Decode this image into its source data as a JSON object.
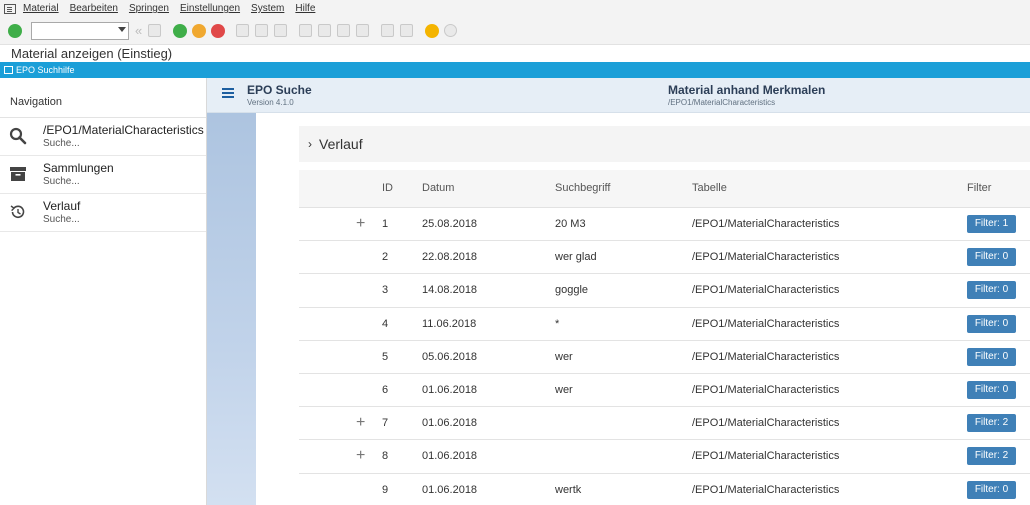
{
  "menubar": {
    "items": [
      "Material",
      "Bearbeiten",
      "Springen",
      "Einstellungen",
      "System",
      "Hilfe"
    ]
  },
  "toolbar": {
    "command_field": "",
    "icons": [
      "enter-icon",
      "save-icon",
      "back-icon",
      "exit-icon",
      "cancel-icon",
      "print-icon",
      "find-icon",
      "find-next-icon",
      "first-page-icon",
      "previous-page-icon",
      "next-page-icon",
      "last-page-icon",
      "create-session-icon",
      "shortcut-icon",
      "help-icon",
      "settings-icon"
    ]
  },
  "titlebar": {
    "title": "Material anzeigen (Einstieg)"
  },
  "window": {
    "title": "EPO Suchhilfe"
  },
  "navigation": {
    "header": "Navigation",
    "items": [
      {
        "title": "/EPO1/MaterialCharacteristics",
        "subtitle": "Suche...",
        "icon": "search-icon"
      },
      {
        "title": "Sammlungen",
        "subtitle": "Suche...",
        "icon": "archive-box-icon"
      },
      {
        "title": "Verlauf",
        "subtitle": "Suche...",
        "icon": "history-icon"
      }
    ]
  },
  "header": {
    "app_title": "EPO Suche",
    "version": "Version 4.1.0",
    "page_title": "Material anhand Merkmalen",
    "page_subtitle": "/EPO1/MaterialCharacteristics"
  },
  "verlauf": {
    "title": "Verlauf"
  },
  "table": {
    "columns": {
      "id": "ID",
      "date": "Datum",
      "term": "Suchbegriff",
      "table": "Tabelle",
      "filter": "Filter"
    },
    "rows": [
      {
        "expand": "+",
        "id": "1",
        "date": "25.08.2018",
        "term": "20 M3",
        "table": "/EPO1/MaterialCharacteristics",
        "filter": "Filter: 1"
      },
      {
        "expand": "",
        "id": "2",
        "date": "22.08.2018",
        "term": "wer glad",
        "table": "/EPO1/MaterialCharacteristics",
        "filter": "Filter: 0"
      },
      {
        "expand": "",
        "id": "3",
        "date": "14.08.2018",
        "term": "goggle",
        "table": "/EPO1/MaterialCharacteristics",
        "filter": "Filter: 0"
      },
      {
        "expand": "",
        "id": "4",
        "date": "11.06.2018",
        "term": "*",
        "table": "/EPO1/MaterialCharacteristics",
        "filter": "Filter: 0"
      },
      {
        "expand": "",
        "id": "5",
        "date": "05.06.2018",
        "term": "wer",
        "table": "/EPO1/MaterialCharacteristics",
        "filter": "Filter: 0"
      },
      {
        "expand": "",
        "id": "6",
        "date": "01.06.2018",
        "term": "wer",
        "table": "/EPO1/MaterialCharacteristics",
        "filter": "Filter: 0"
      },
      {
        "expand": "+",
        "id": "7",
        "date": "01.06.2018",
        "term": "",
        "table": "/EPO1/MaterialCharacteristics",
        "filter": "Filter: 2"
      },
      {
        "expand": "+",
        "id": "8",
        "date": "01.06.2018",
        "term": "",
        "table": "/EPO1/MaterialCharacteristics",
        "filter": "Filter: 2"
      },
      {
        "expand": "",
        "id": "9",
        "date": "01.06.2018",
        "term": "wertk",
        "table": "/EPO1/MaterialCharacteristics",
        "filter": "Filter: 0"
      }
    ]
  },
  "colors": {
    "window_strip": "#1b9fd8",
    "filter_button": "#3f80b7",
    "header_bg": "#e6eef6"
  }
}
